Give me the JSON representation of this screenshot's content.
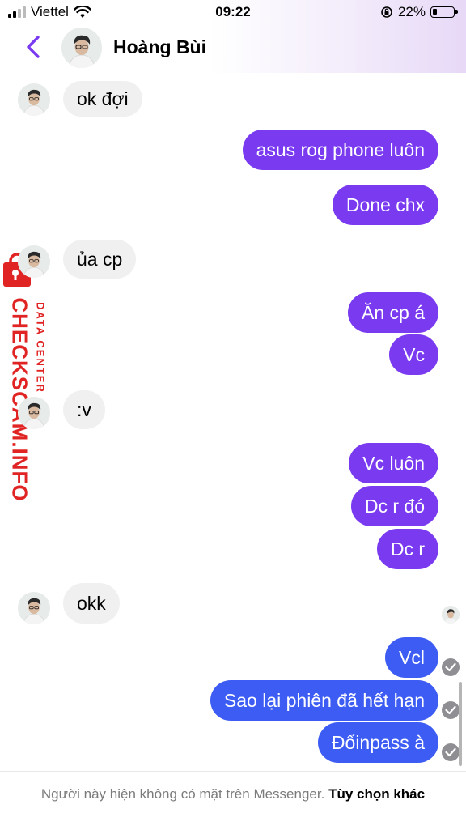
{
  "status_bar": {
    "carrier": "Viettel",
    "time": "09:22",
    "battery_percent": "22%",
    "battery_level": 0.22,
    "icons": [
      "signal-icon",
      "wifi-icon",
      "orientation-lock-icon",
      "battery-icon"
    ]
  },
  "header": {
    "contact_name": "Hoàng Bùi",
    "back_icon": "chevron-left-icon",
    "accent_color": "#7a3bf0"
  },
  "messages": [
    {
      "side": "in",
      "text": "ok đợi"
    },
    {
      "side": "out",
      "text": "asus rog phone luôn"
    },
    {
      "side": "out",
      "text": "Done chx"
    },
    {
      "side": "in",
      "text": "ủa cp"
    },
    {
      "side": "out",
      "text": "Ăn cp á"
    },
    {
      "side": "out",
      "text": "Vc"
    },
    {
      "side": "in",
      "text": ":v"
    },
    {
      "side": "out",
      "text": "Vc luôn"
    },
    {
      "side": "out",
      "text": "Dc r đó"
    },
    {
      "side": "out",
      "text": "Dc r"
    },
    {
      "side": "in",
      "text": "okk"
    },
    {
      "side": "out",
      "text": "Vcl"
    },
    {
      "side": "out",
      "text": "Sao lại phiên đã hết hạn"
    },
    {
      "side": "out",
      "text": "Đổinpass à"
    }
  ],
  "watermark": {
    "main": "CHECKSCAM.INFO",
    "sub": "DATA CENTER"
  },
  "footer": {
    "notice": "Người này hiện không có mặt trên Messenger.",
    "action": "Tùy chọn khác"
  },
  "colors": {
    "outgoing_purple": "#7a3bf0",
    "outgoing_blue": "#3c5cf3",
    "incoming_gray": "#f0f0f0",
    "watermark_red": "#e02424"
  }
}
